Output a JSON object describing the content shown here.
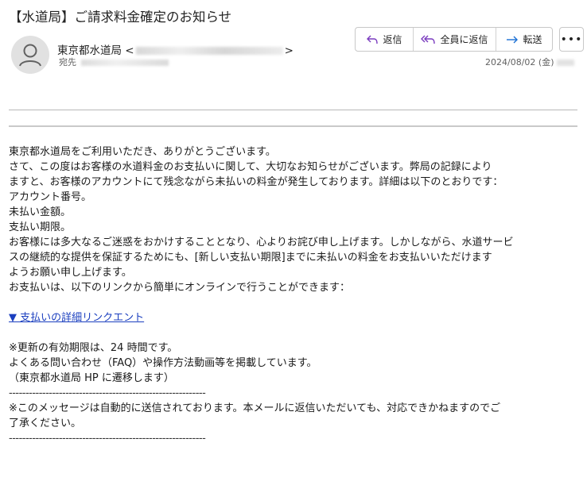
{
  "email": {
    "subject": "【水道局】ご請求料金確定のお知らせ",
    "sender_name": "東京都水道局",
    "to_label": "宛先",
    "date": "2024/08/02 (金)"
  },
  "toolbar": {
    "reply_label": "返信",
    "reply_all_label": "全員に返信",
    "forward_label": "転送",
    "more_label": "•••"
  },
  "body": {
    "line1": "東京都水道局をご利用いただき、ありがとうございます。",
    "line2": "さて、この度はお客様の水道料金のお支払いに関して、大切なお知らせがございます。弊局の記録により",
    "line3": "ますと、お客様のアカウントにて残念ながら未払いの料金が発生しております。詳細は以下のとおりです：",
    "line4": "アカウント番号。",
    "line5": "未払い金額。",
    "line6": "支払い期限。",
    "line7": "お客様には多大なるご迷惑をおかけすることとなり、心よりお詫び申し上げます。しかしながら、水道サービ",
    "line8": "スの継続的な提供を保証するためにも、[新しい支払い期限]までに未払いの料金をお支払いいただけます",
    "line9": "ようお願い申し上げます。",
    "line10": "お支払いは、以下のリンクから簡単にオンラインで行うことができます：",
    "link": "▼ 支払いの詳細リンクエント",
    "line11": "※更新の有効期限は、24 時間です。",
    "line12": "よくある問い合わせ（FAQ）や操作方法動画等を掲載しています。",
    "line13": "（東京都水道局 HP に遷移します）",
    "divider1": "-----------------------------------------------------------",
    "line14": "※このメッセージは自動的に送信されております。本メールに返信いただいても、対応できかねますのでご",
    "line15": "了承ください。",
    "divider2": "-----------------------------------------------------------"
  }
}
